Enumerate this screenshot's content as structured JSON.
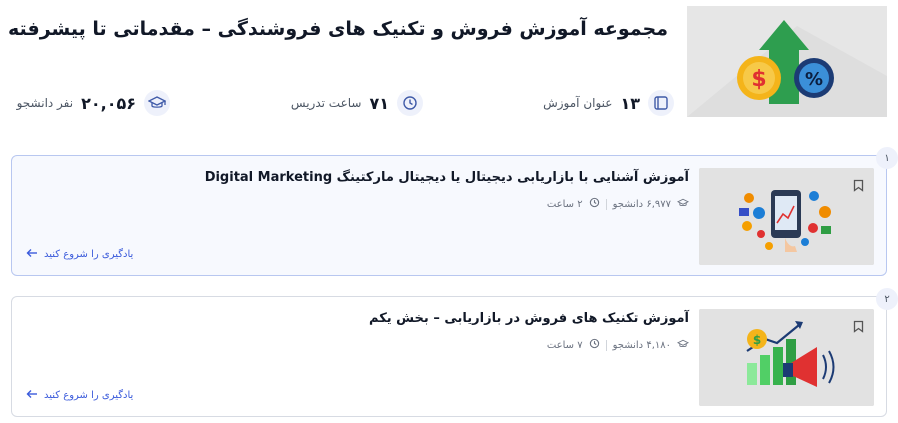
{
  "course": {
    "title": "مجموعه آموزش فروش و تکنیک های فروشندگی – مقدماتی تا پیشرفته",
    "stats": [
      {
        "icon": "lessons-icon",
        "value": "۱۳",
        "label": "عنوان آموزش"
      },
      {
        "icon": "clock-icon",
        "value": "۷۱",
        "label": "ساعت تدریس"
      },
      {
        "icon": "graduation-cap-icon",
        "value": "۲۰,۰۵۶",
        "label": "نفر دانشجو"
      }
    ]
  },
  "items": [
    {
      "index": "۱",
      "title": "آموزش آشنایی با بازاریابی دیجیتال یا دیجیتال مارکتینگ Digital Marketing",
      "students": "۶,۹۷۷ دانشجو",
      "hours": "۲ ساعت",
      "cta": "یادگیری را شروع کنید"
    },
    {
      "index": "۲",
      "title": "آموزش تکنیک های فروش در بازاریابی – بخش یکم",
      "students": "۴,۱۸۰ دانشجو",
      "hours": "۷ ساعت",
      "cta": "یادگیری را شروع کنید"
    }
  ],
  "colors": {
    "accent": "#3b5bdb",
    "iconBg": "#eef1fb",
    "activeCardBg": "#f7f9fe"
  }
}
